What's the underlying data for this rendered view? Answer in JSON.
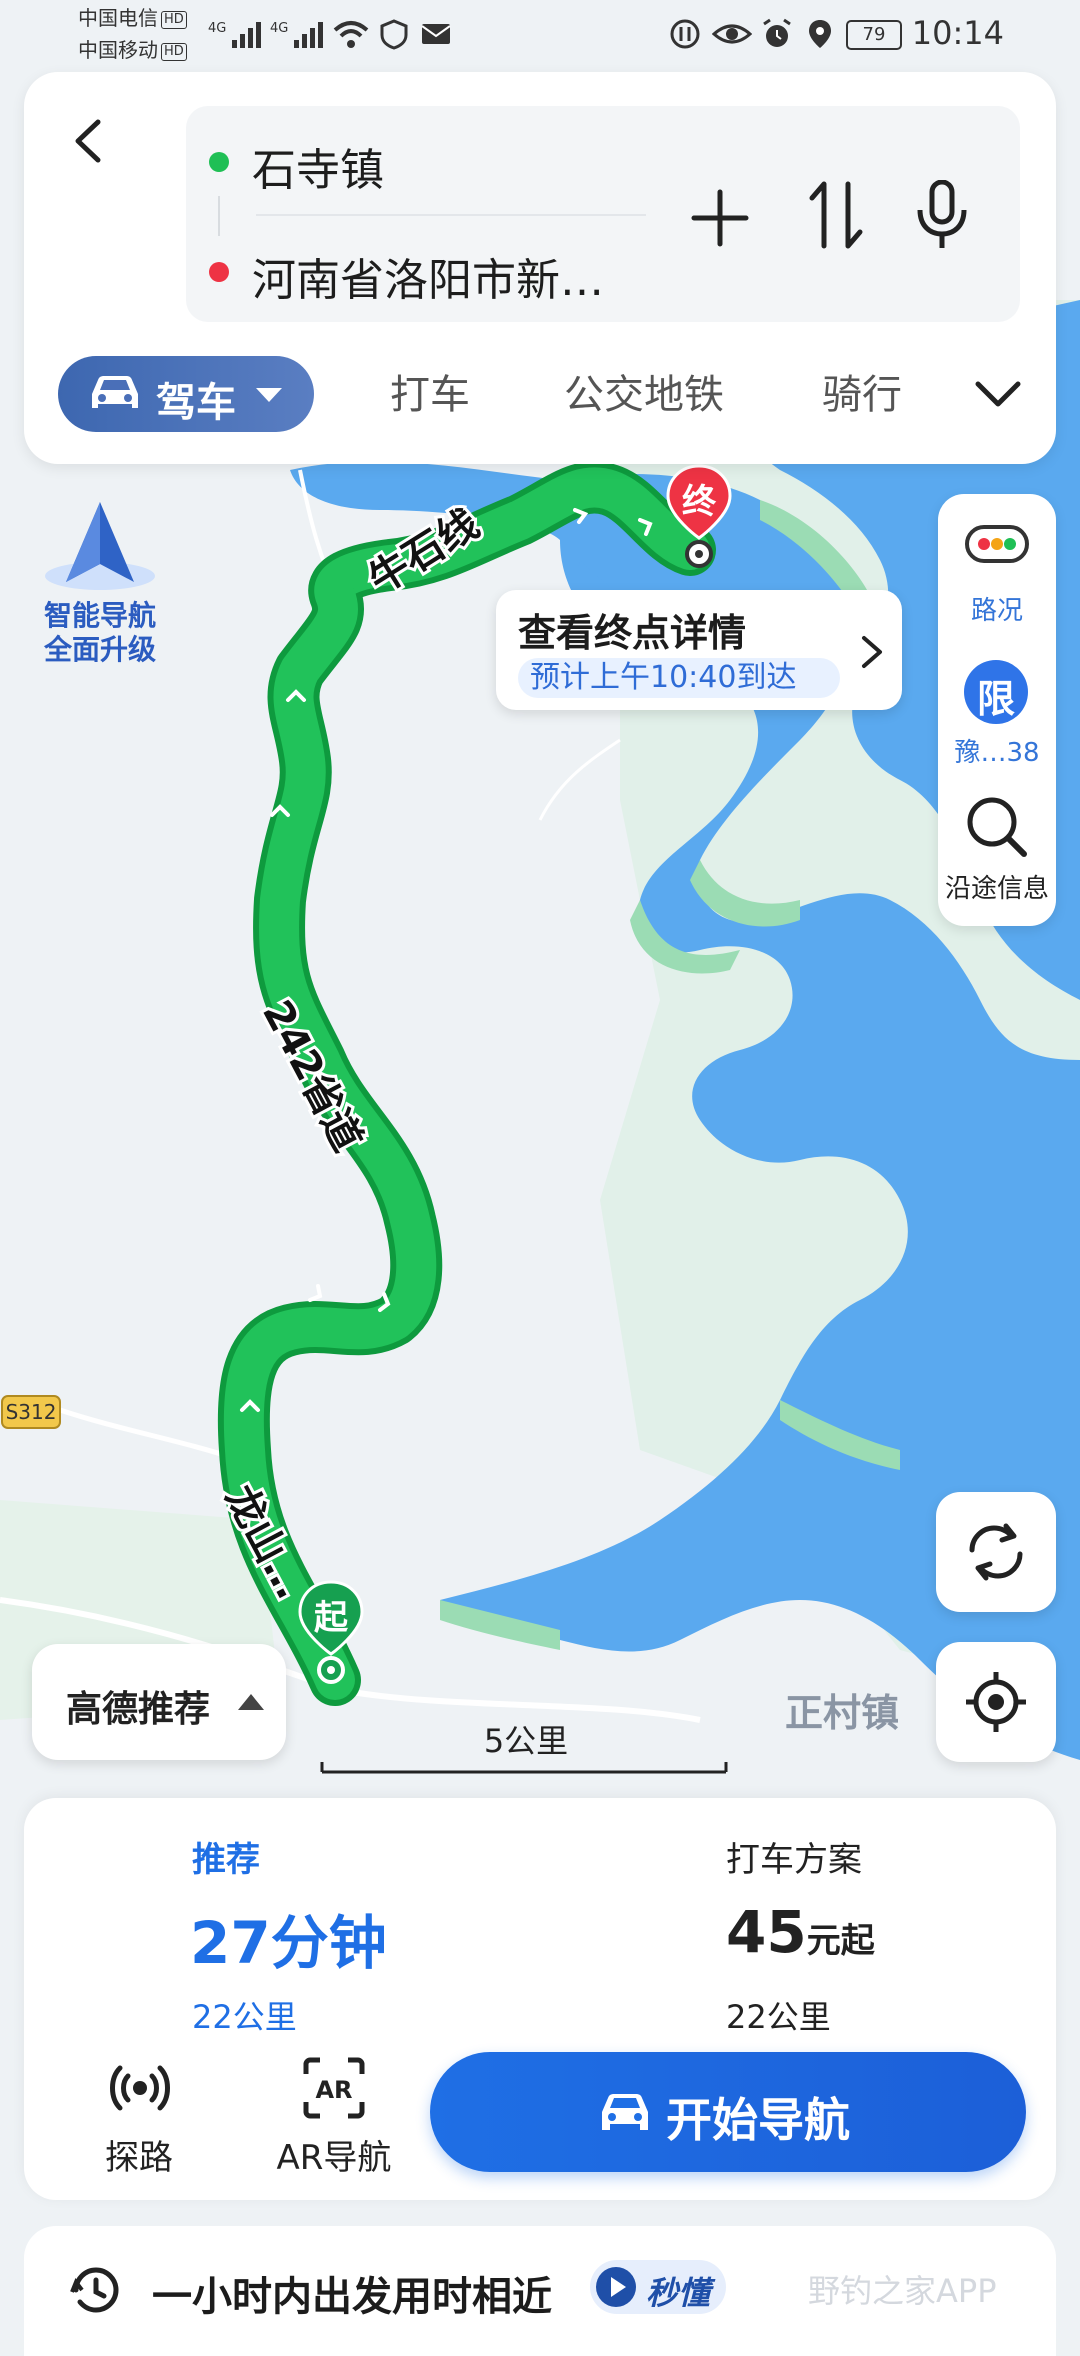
{
  "status_bar": {
    "carrier_1": "中国电信",
    "carrier_2": "中国移动",
    "hd": "HD",
    "net_1": "4G",
    "net_2": "4G",
    "battery": "79",
    "time": "10:14"
  },
  "route": {
    "origin": "石寺镇",
    "destination": "河南省洛阳市新…"
  },
  "mode_tabs": {
    "active": "驾车",
    "taxi": "打车",
    "transit": "公交地铁",
    "bike": "骑行"
  },
  "smart_nav": {
    "line1": "智能导航",
    "line2": "全面升级"
  },
  "right_panel": {
    "traffic_label": "路况",
    "restrict_badge": "限",
    "restrict_label": "豫…38",
    "along_label": "沿途信息"
  },
  "callout": {
    "title": "查看终点详情",
    "eta": "预计上午10:40到达"
  },
  "map_labels": {
    "end_marker": "终",
    "start_marker": "起",
    "road_s312": "S312",
    "road_niushi": "牛石线",
    "road_242": "242省道",
    "road_longshan": "龙山…",
    "town": "正村镇",
    "scale": "5公里",
    "recommend_chip": "高德推荐"
  },
  "plan": {
    "tag": "推荐",
    "duration": "27分钟",
    "distance": "22公里",
    "taxi_title": "打车方案",
    "taxi_price_num": "45",
    "taxi_price_unit": "元起",
    "taxi_distance": "22公里"
  },
  "actions": {
    "probe": "探路",
    "ar": "AR导航",
    "start": "开始导航"
  },
  "footer": {
    "text": "一小时内出发用时相近",
    "badge": "秒懂",
    "watermark": "野钓之家APP"
  },
  "colors": {
    "route_green": "#1fbf55",
    "water_blue": "#5aa9ef",
    "accent_blue": "#1f6fe5",
    "end_red": "#ee3344"
  }
}
